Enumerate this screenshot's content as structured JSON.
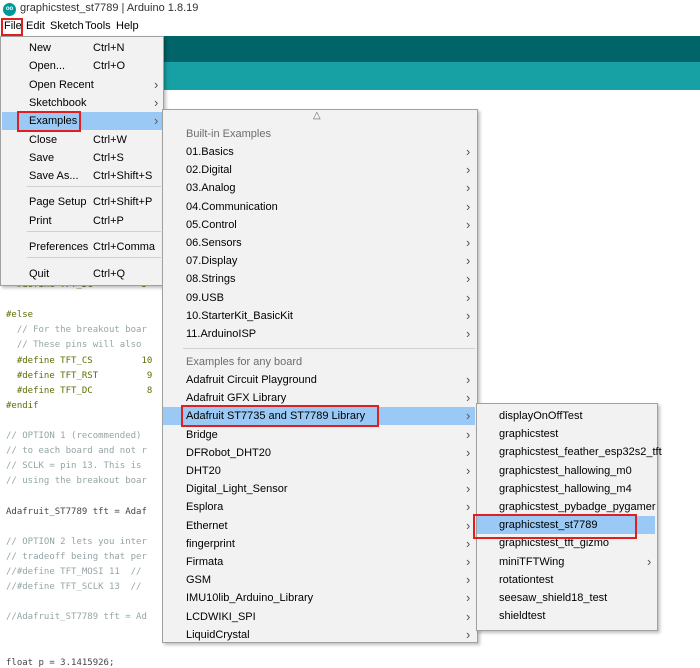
{
  "window": {
    "title": "graphicstest_st7789 | Arduino 1.8.19",
    "icon_text": "oo"
  },
  "menubar": [
    "File",
    "Edit",
    "Sketch",
    "Tools",
    "Help"
  ],
  "code_lines": [
    "  #define TFT_DC         5",
    "",
    "#else",
    "  // For the breakout boar",
    "  // These pins will also",
    "  #define TFT_CS         10",
    "  #define TFT_RST         9",
    "  #define TFT_DC          8",
    "#endif",
    "",
    "// OPTION 1 (recommended)",
    "// to each board and not r",
    "// SCLK = pin 13. This is",
    "// using the breakout boar",
    "",
    "Adafruit_ST7789 tft = Adaf",
    "",
    "// OPTION 2 lets you inter",
    "// tradeoff being that per",
    "//#define TFT_MOSI 11  //",
    "//#define TFT_SCLK 13  //",
    "",
    "//Adafruit_ST7789 tft = Ad",
    "",
    "",
    "float p = 3.1415926;"
  ],
  "file_menu": [
    {
      "label": "New",
      "shortcut": "Ctrl+N"
    },
    {
      "label": "Open...",
      "shortcut": "Ctrl+O"
    },
    {
      "label": "Open Recent",
      "shortcut": "",
      "submenu": true
    },
    {
      "label": "Sketchbook",
      "shortcut": "",
      "submenu": true
    },
    {
      "label": "Examples",
      "shortcut": "",
      "submenu": true,
      "selected": true
    },
    {
      "label": "Close",
      "shortcut": "Ctrl+W"
    },
    {
      "label": "Save",
      "shortcut": "Ctrl+S"
    },
    {
      "label": "Save As...",
      "shortcut": "Ctrl+Shift+S"
    },
    {
      "label": "Page Setup",
      "shortcut": "Ctrl+Shift+P"
    },
    {
      "label": "Print",
      "shortcut": "Ctrl+P"
    },
    {
      "label": "Preferences",
      "shortcut": "Ctrl+Comma"
    },
    {
      "label": "Quit",
      "shortcut": "Ctrl+Q"
    }
  ],
  "examples_menu": {
    "scroll_up_glyph": "△",
    "builtin_header": "Built-in Examples",
    "builtin": [
      "01.Basics",
      "02.Digital",
      "03.Analog",
      "04.Communication",
      "05.Control",
      "06.Sensors",
      "07.Display",
      "08.Strings",
      "09.USB",
      "10.StarterKit_BasicKit",
      "11.ArduinoISP"
    ],
    "any_header": "Examples for any board",
    "any_board": [
      "Adafruit Circuit Playground",
      "Adafruit GFX Library",
      "Adafruit ST7735 and ST7789 Library",
      "Bridge",
      "DFRobot_DHT20",
      "DHT20",
      "Digital_Light_Sensor",
      "Esplora",
      "Ethernet",
      "fingerprint",
      "Firmata",
      "GSM",
      "IMU10lib_Arduino_Library",
      "LCDWIKI_SPI",
      "LiquidCrystal"
    ],
    "selected": "Adafruit ST7735 and ST7789 Library"
  },
  "library_menu": {
    "items": [
      "displayOnOffTest",
      "graphicstest",
      "graphicstest_feather_esp32s2_tft",
      "graphicstest_hallowing_m0",
      "graphicstest_hallowing_m4",
      "graphicstest_pybadge_pygamer",
      "graphicstest_st7789",
      "graphicstest_tft_gizmo",
      "miniTFTWing",
      "rotationtest",
      "seesaw_shield18_test",
      "shieldtest"
    ],
    "selected": "graphicstest_st7789",
    "submenu_items": [
      "miniTFTWing"
    ]
  },
  "colors": {
    "highlight": "#99c9f4",
    "annotation": "#e02020",
    "toolbar_dark": "#006468",
    "toolbar_light": "#17a1a5"
  }
}
